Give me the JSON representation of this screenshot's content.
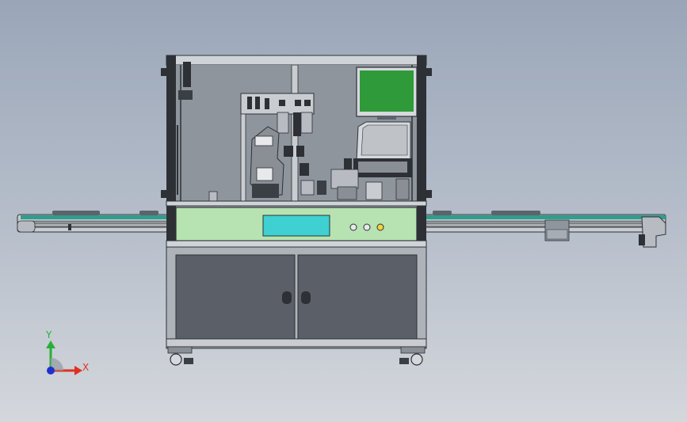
{
  "viewport": {
    "background_top": "#9aa6b8",
    "background_bottom": "#d4d7dc"
  },
  "machine": {
    "frame_color": "#2d3136",
    "enclosure_glass_color": "#8f959d",
    "panel_color": "#b6e3b1",
    "display_color": "#3fd0d2",
    "monitor_screen_color": "#2f9a3a",
    "cabinet_color": "#5b6068",
    "conveyor_belt_color": "#2e9e8e"
  },
  "triad": {
    "x_label": "X",
    "y_label": "Y",
    "x_color": "#e03020",
    "y_color": "#27b035",
    "z_color": "#2030d0"
  }
}
